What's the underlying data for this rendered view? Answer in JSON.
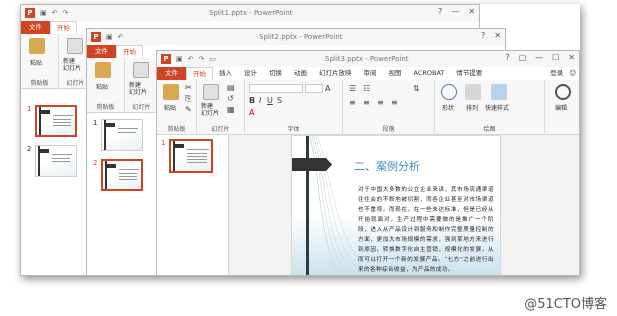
{
  "windows": [
    {
      "title": "Split1.pptx - PowerPoint",
      "tabs": [
        "文件",
        "开始"
      ],
      "clipboard": "剪贴板",
      "paste": "粘贴",
      "slides_nums": [
        "1",
        "2"
      ]
    },
    {
      "title": "Split2.pptx - PowerPoint",
      "tabs": [
        "文件",
        "开始"
      ],
      "clipboard": "剪贴板",
      "paste": "粘贴",
      "new_slide": "新建\n幻灯片",
      "slides_group": "幻灯片",
      "slides_nums": [
        "1",
        "2"
      ]
    },
    {
      "title": "Split3.pptx - PowerPoint",
      "tabs": [
        "文件",
        "开始",
        "插入",
        "设计",
        "切换",
        "动画",
        "幻灯片放映",
        "审阅",
        "视图",
        "ACROBAT",
        "情节提要"
      ],
      "login": "登录",
      "groups": {
        "clipboard": "剪贴板",
        "slides": "幻灯片",
        "font": "字体",
        "paragraph": "段落",
        "drawing": "绘图"
      },
      "buttons": {
        "paste": "粘贴",
        "new_slide": "新建\n幻灯片",
        "shape": "形状",
        "arrange": "排列",
        "quick_styles": "快速样式",
        "editing": "编辑"
      },
      "slides_nums": [
        "1"
      ]
    }
  ],
  "win1_new_slide": "新建\n幻灯片",
  "win1_slides_group": "幻灯片",
  "win2_tab_active": "开始",
  "slide": {
    "heading": "二、案例分析",
    "body": "对于中国大多数的公立企业来讲，其市场流通渠道往往会的不断地被切割，而各企业甚至对市场渠道也不重视。而现在，在一些未达标准，但是已经从开始就面对，生产过程中需要做的是推广一个阶段，进入从产品设计到服务和制作完整质量控制的方面，更加大市场规模的需求，强到某地方来进行到原因。转换数字化自主营销，规模化的发展，从而可以打开一个新的发展产品。“七方”之前进行出来的各种综合收益，为产品的成功。"
  },
  "watermark": "@51CTO博客"
}
